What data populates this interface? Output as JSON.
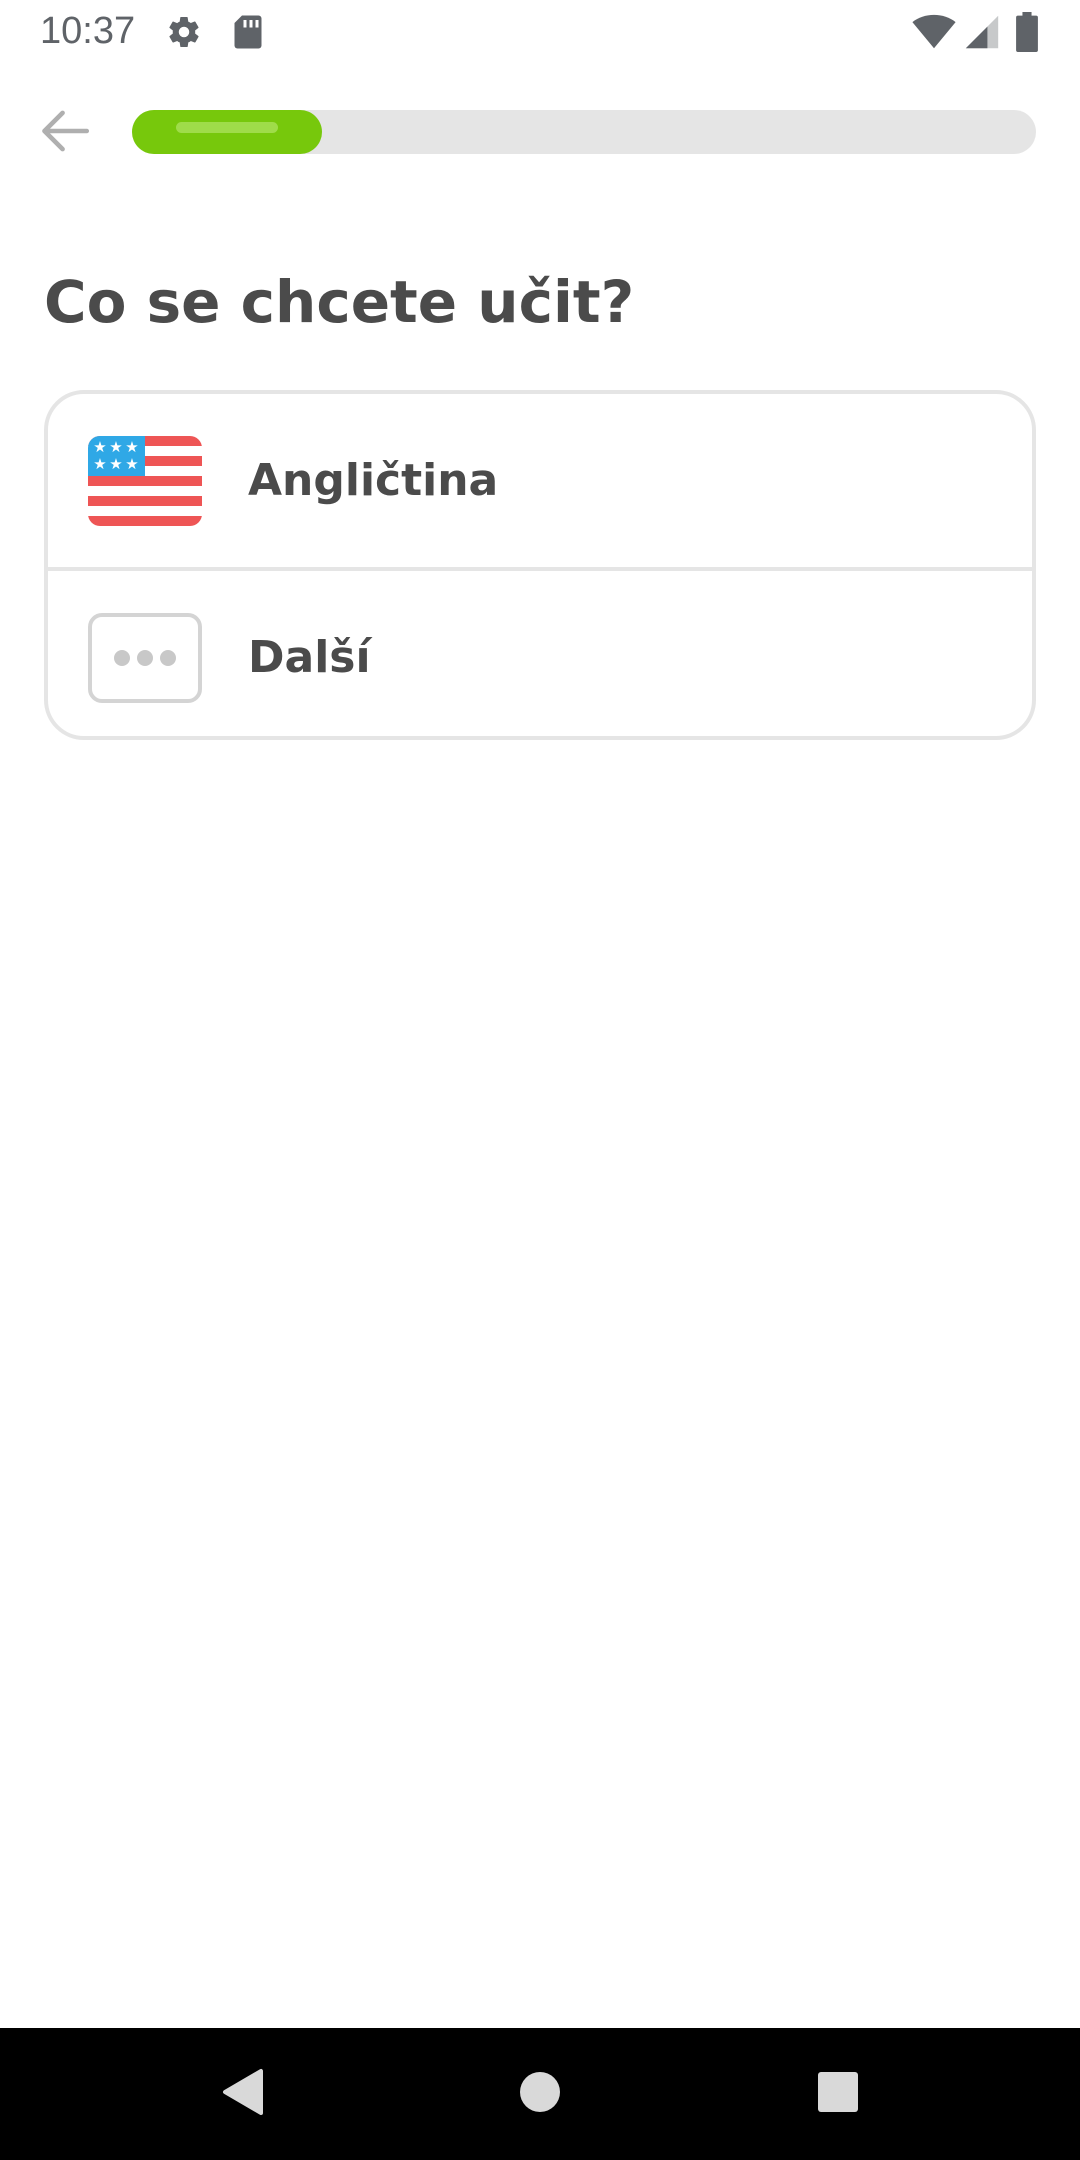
{
  "status_bar": {
    "time": "10:37",
    "icons": [
      "gear-icon",
      "sd-card-icon",
      "wifi-icon",
      "signal-icon",
      "battery-icon"
    ]
  },
  "header": {
    "back_icon": "arrow-left-icon",
    "progress_fraction": 0.21
  },
  "question": {
    "title": "Co se chcete učit?"
  },
  "options": [
    {
      "label": "Angličtina",
      "icon": "us-flag-icon"
    },
    {
      "label": "Další",
      "icon": "more-dots-icon"
    }
  ],
  "nav_bar": {
    "icons": [
      "nav-back-icon",
      "nav-home-icon",
      "nav-recents-icon"
    ]
  },
  "colors": {
    "progress_fill": "#77c80c",
    "progress_track": "#e5e5e5",
    "text": "#4b4b4b",
    "card_border": "#e5e5e5"
  }
}
